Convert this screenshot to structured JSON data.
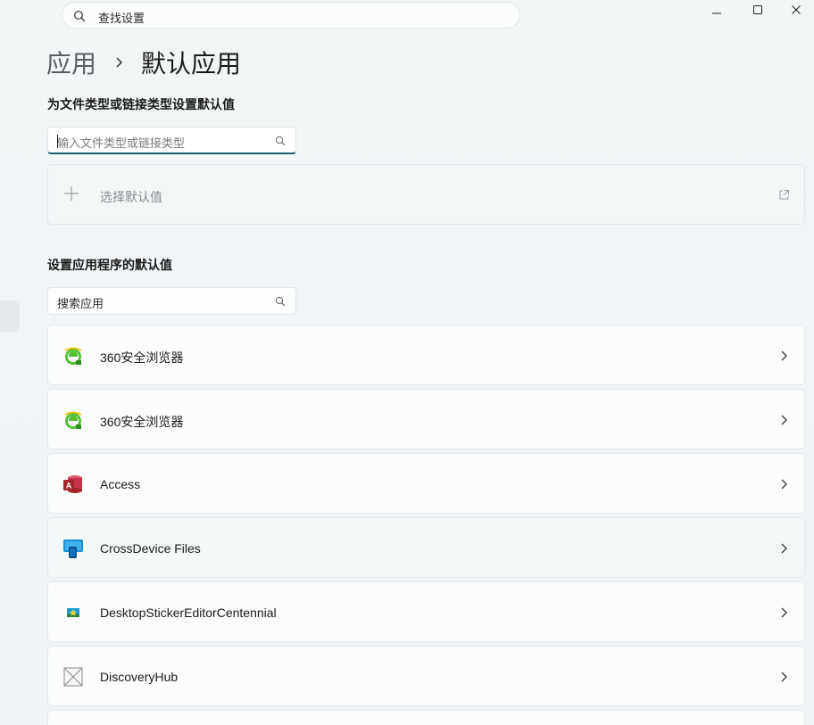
{
  "search": {
    "placeholder": "查找设置",
    "icon": "search-icon"
  },
  "window_controls": {
    "minimize": "minimize-icon",
    "maximize": "maximize-icon",
    "close": "close-icon"
  },
  "breadcrumb": {
    "parent": "应用",
    "current": "默认应用"
  },
  "file_type_section": {
    "title": "为文件类型或链接类型设置默认值",
    "input_placeholder": "输入文件类型或链接类型",
    "choose_label": "选择默认值"
  },
  "app_section": {
    "title": "设置应用程序的默认值",
    "search_value": "搜索应用"
  },
  "apps": [
    {
      "name": "360安全浏览器",
      "icon": "360-browser-icon"
    },
    {
      "name": "360安全浏览器",
      "icon": "360-browser-icon"
    },
    {
      "name": "Access",
      "icon": "access-icon"
    },
    {
      "name": "CrossDevice Files",
      "icon": "crossdevice-icon"
    },
    {
      "name": "DesktopStickerEditorCentennial",
      "icon": "sticker-editor-icon"
    },
    {
      "name": "DiscoveryHub",
      "icon": "placeholder-app-icon"
    }
  ],
  "colors": {
    "accent": "#1a5d6c",
    "background": "#f1f5f7",
    "card": "#fbfdfd"
  }
}
